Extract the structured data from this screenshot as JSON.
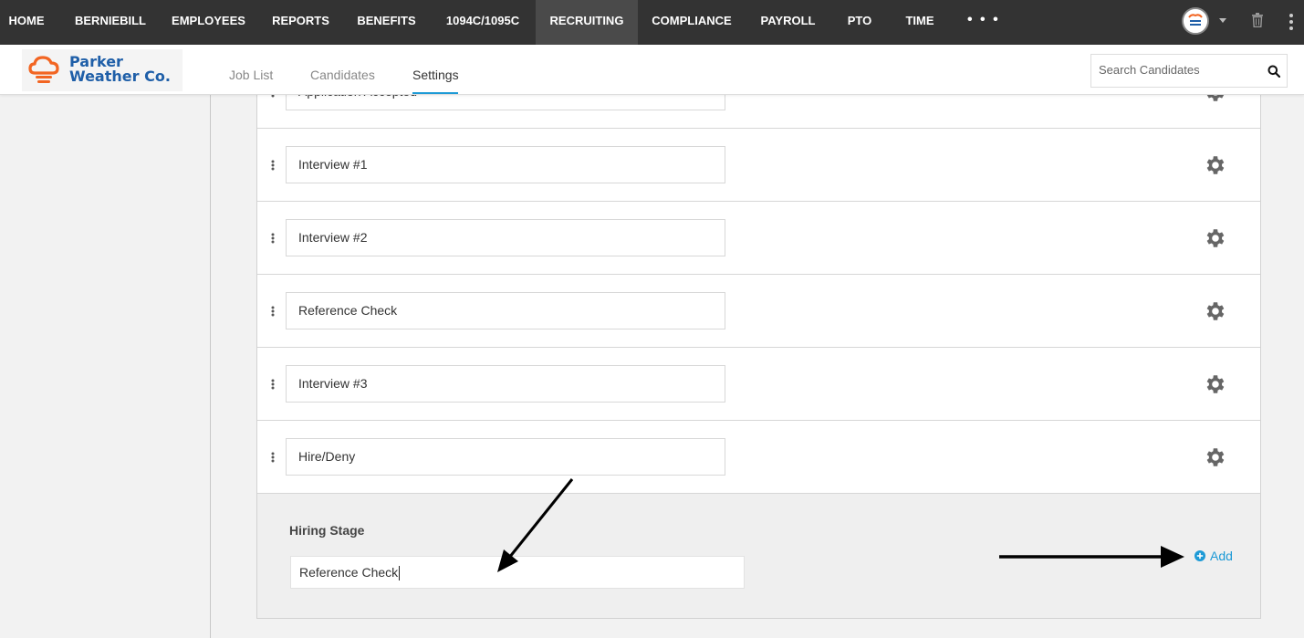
{
  "topnav": {
    "items": [
      "HOME",
      "BERNIEBILL",
      "EMPLOYEES",
      "REPORTS",
      "BENEFITS",
      "1094C/1095C",
      "RECRUITING",
      "COMPLIANCE",
      "PAYROLL",
      "PTO",
      "TIME"
    ],
    "active": "RECRUITING",
    "more": "• • •"
  },
  "brand": {
    "line1": "Parker",
    "line2": "Weather Co.",
    "color": "#1f5fa8",
    "icon_color": "#f26522"
  },
  "subnav": {
    "tabs": [
      "Job List",
      "Candidates",
      "Settings"
    ],
    "active": "Settings"
  },
  "search": {
    "placeholder": "Search Candidates"
  },
  "stages": [
    "Application Accepted",
    "Interview #1",
    "Interview #2",
    "Reference Check",
    "Interview #3",
    "Hire/Deny"
  ],
  "add_stage": {
    "label": "Hiring Stage",
    "value": "Reference Check",
    "button": "Add"
  },
  "colors": {
    "accent": "#1d9ad6",
    "topbar": "#333333",
    "active_tab": "#4a4a4a"
  }
}
